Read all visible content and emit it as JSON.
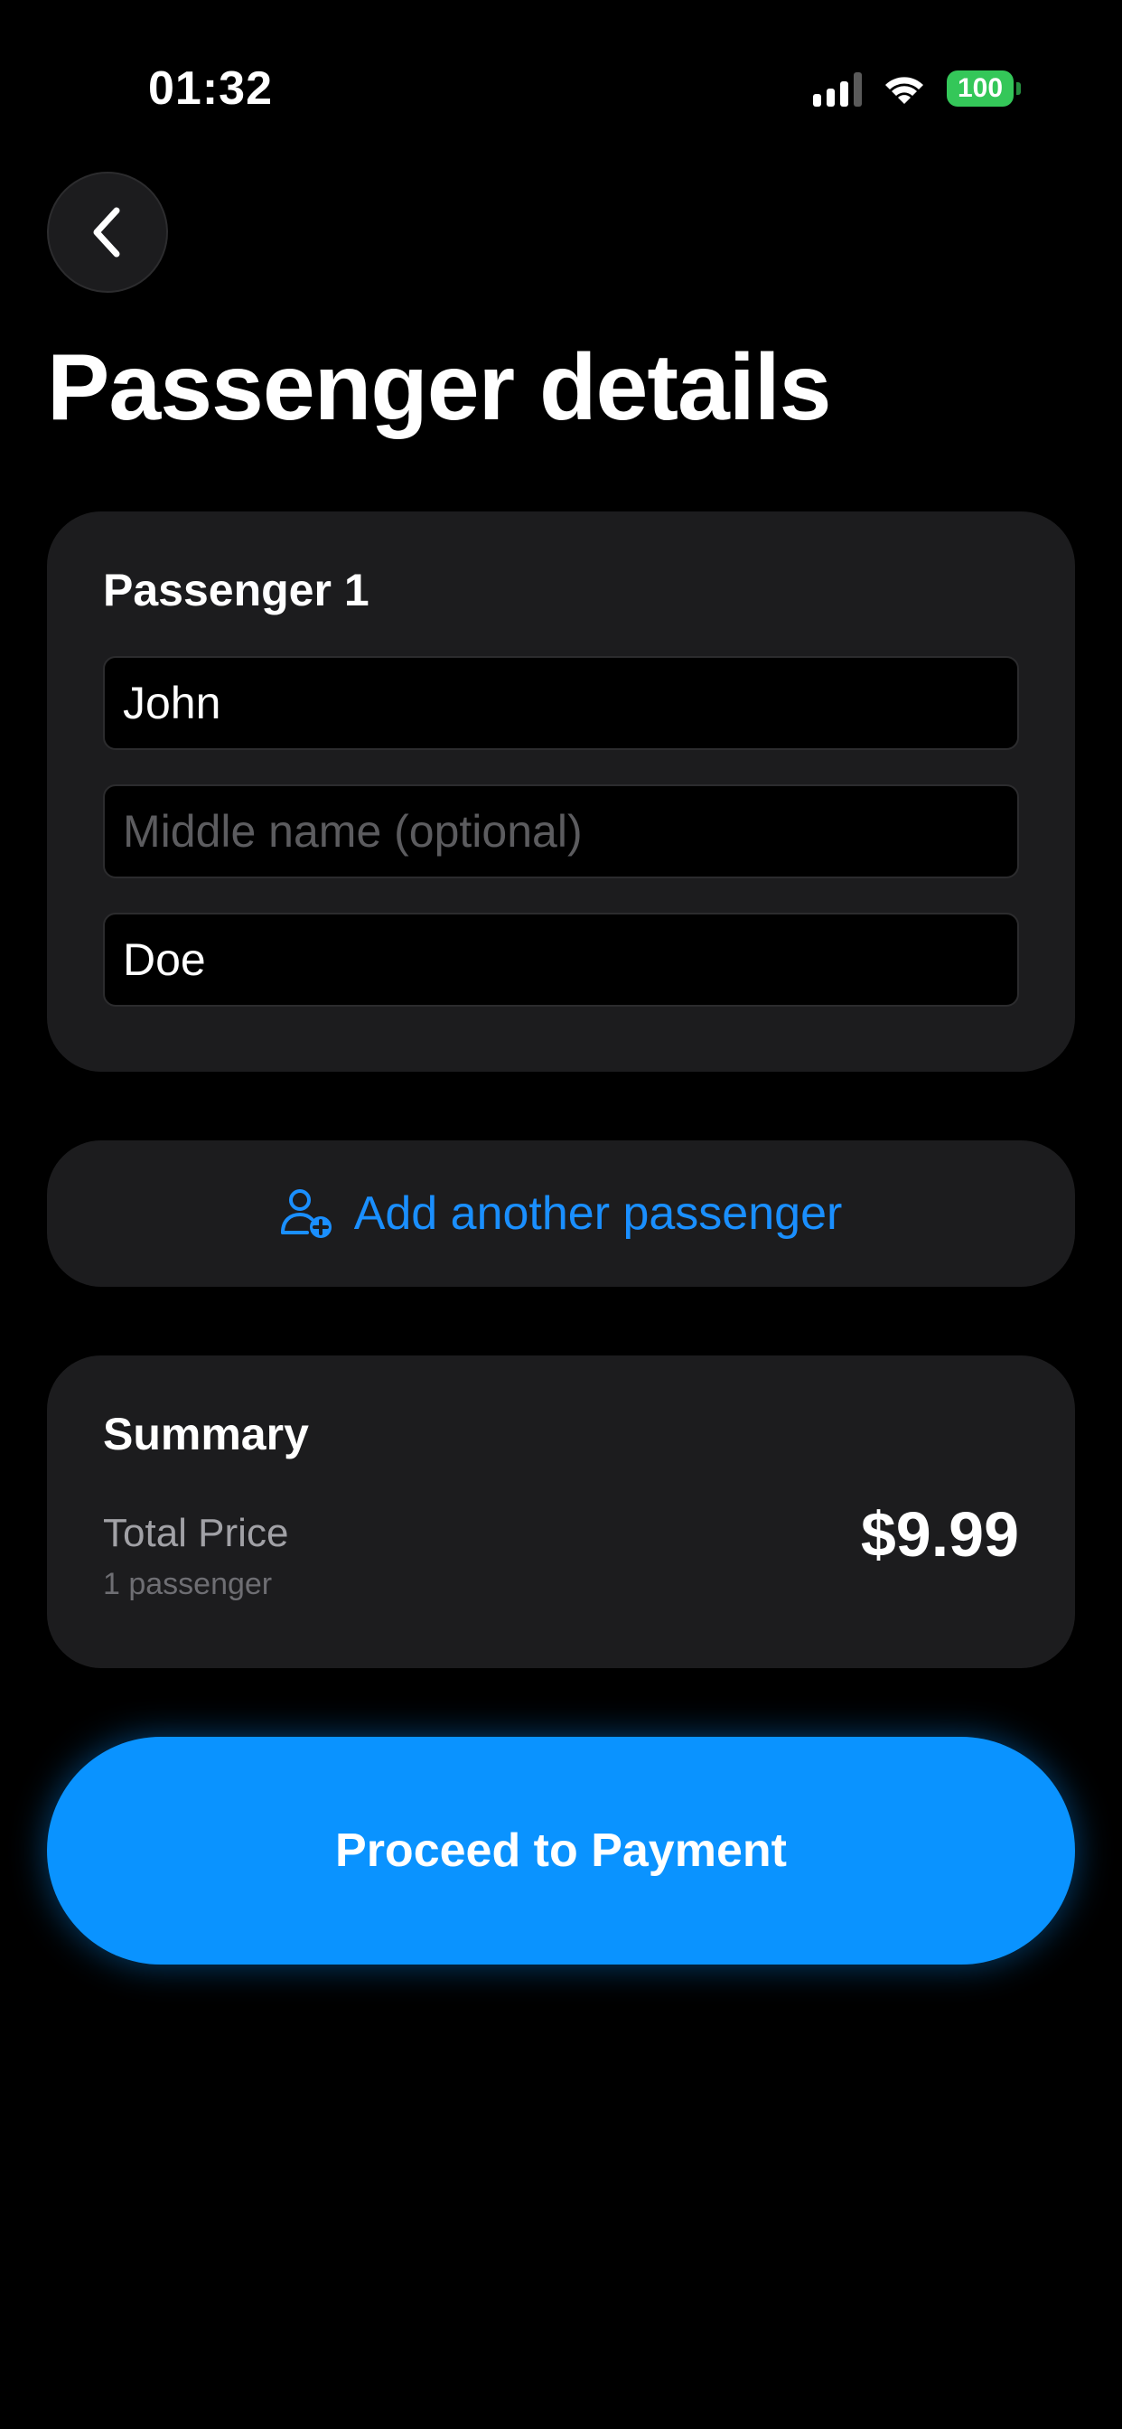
{
  "status_bar": {
    "time": "01:32",
    "battery": "100",
    "icons": [
      "signal-icon",
      "wifi-icon",
      "battery-icon"
    ]
  },
  "header": {
    "back_icon": "chevron-left-icon",
    "title": "Passenger details"
  },
  "passenger_card": {
    "heading": "Passenger 1",
    "first_name": {
      "value": "John",
      "placeholder": ""
    },
    "middle_name": {
      "value": "",
      "placeholder": "Middle name (optional)"
    },
    "last_name": {
      "value": "Doe",
      "placeholder": ""
    }
  },
  "add_passenger": {
    "icon": "person-add-icon",
    "label": "Add another passenger"
  },
  "summary": {
    "heading": "Summary",
    "total_label": "Total Price",
    "passenger_count": "1 passenger",
    "total_value": "$9.99"
  },
  "proceed_button": {
    "label": "Proceed to Payment"
  },
  "colors": {
    "background": "#000000",
    "card": "#1c1c1e",
    "accent": "#0a93ff",
    "link": "#1a8fff",
    "battery": "#34c759"
  }
}
